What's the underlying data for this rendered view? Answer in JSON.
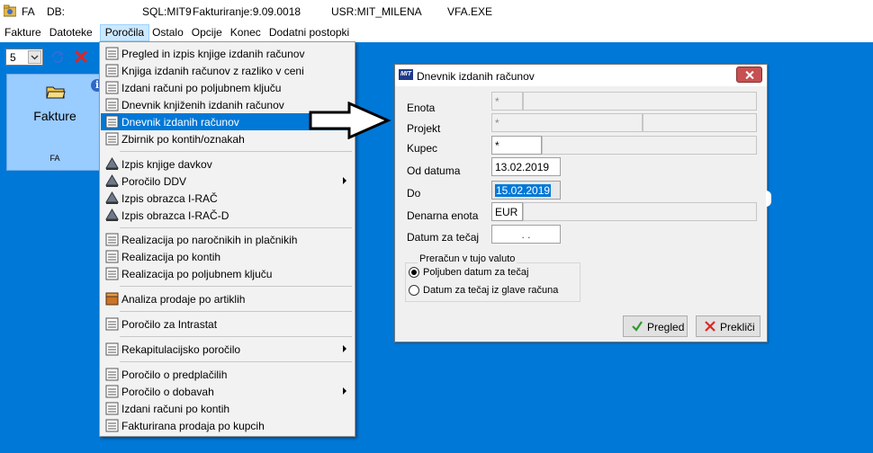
{
  "titlebar": {
    "app": "FA",
    "db": "DB:",
    "sql": "SQL:MIT9",
    "fakturiranje": "Fakturiranje:9.09.0018",
    "user": "USR:MIT_MILENA",
    "exe": "VFA.EXE"
  },
  "menu": [
    "Fakture",
    "Datoteke",
    "Poročila",
    "Ostalo",
    "Opcije",
    "Konec",
    "Dodatni postopki"
  ],
  "toolbar": {
    "combo_value": "5"
  },
  "tile": {
    "label": "Fakture",
    "sub": "FA"
  },
  "dropdown": {
    "items": [
      "Pregled in izpis knjige izdanih računov",
      "Knjiga izdanih računov z razliko v ceni",
      "Izdani računi po poljubnem ključu",
      "Dnevnik knjiženih izdanih računov",
      "Dnevnik izdanih računov",
      "Zbirnik po kontih/oznakah",
      "Izpis knjige davkov",
      "Poročilo DDV",
      "Izpis obrazca I-RAČ",
      "Izpis obrazca I-RAČ-D",
      "Realizacija po naročnikih in plačnikih",
      "Realizacija po kontih",
      "Realizacija po poljubnem ključu",
      "Analiza prodaje po artiklih",
      "Poročilo za Intrastat",
      "Rekapitulacijsko poročilo",
      "Poročilo o predplačilih",
      "Poročilo o dobavah",
      "Izdani računi po kontih",
      "Fakturirana prodaja po kupcih"
    ]
  },
  "dialog": {
    "title": "Dnevnik izdanih računov",
    "labels": {
      "enota": "Enota",
      "projekt": "Projekt",
      "kupec": "Kupec",
      "od_datuma": "Od datuma",
      "do": "Do",
      "denarna_enota": "Denarna enota",
      "datum_za_tecaj": "Datum za tečaj"
    },
    "values": {
      "enota": "*",
      "projekt": "*",
      "kupec": "*",
      "od_datuma": "13.02.2019",
      "do": "15.02.2019",
      "denarna_enota": "EUR",
      "datum_za_tecaj": ". ."
    },
    "group_title": "Preračun v tujo valuto",
    "radio1": "Poljuben datum za tečaj",
    "radio2": "Datum za tečaj iz glave računa",
    "btn_pregled": "Pregled",
    "btn_preklici": "Prekliči"
  }
}
